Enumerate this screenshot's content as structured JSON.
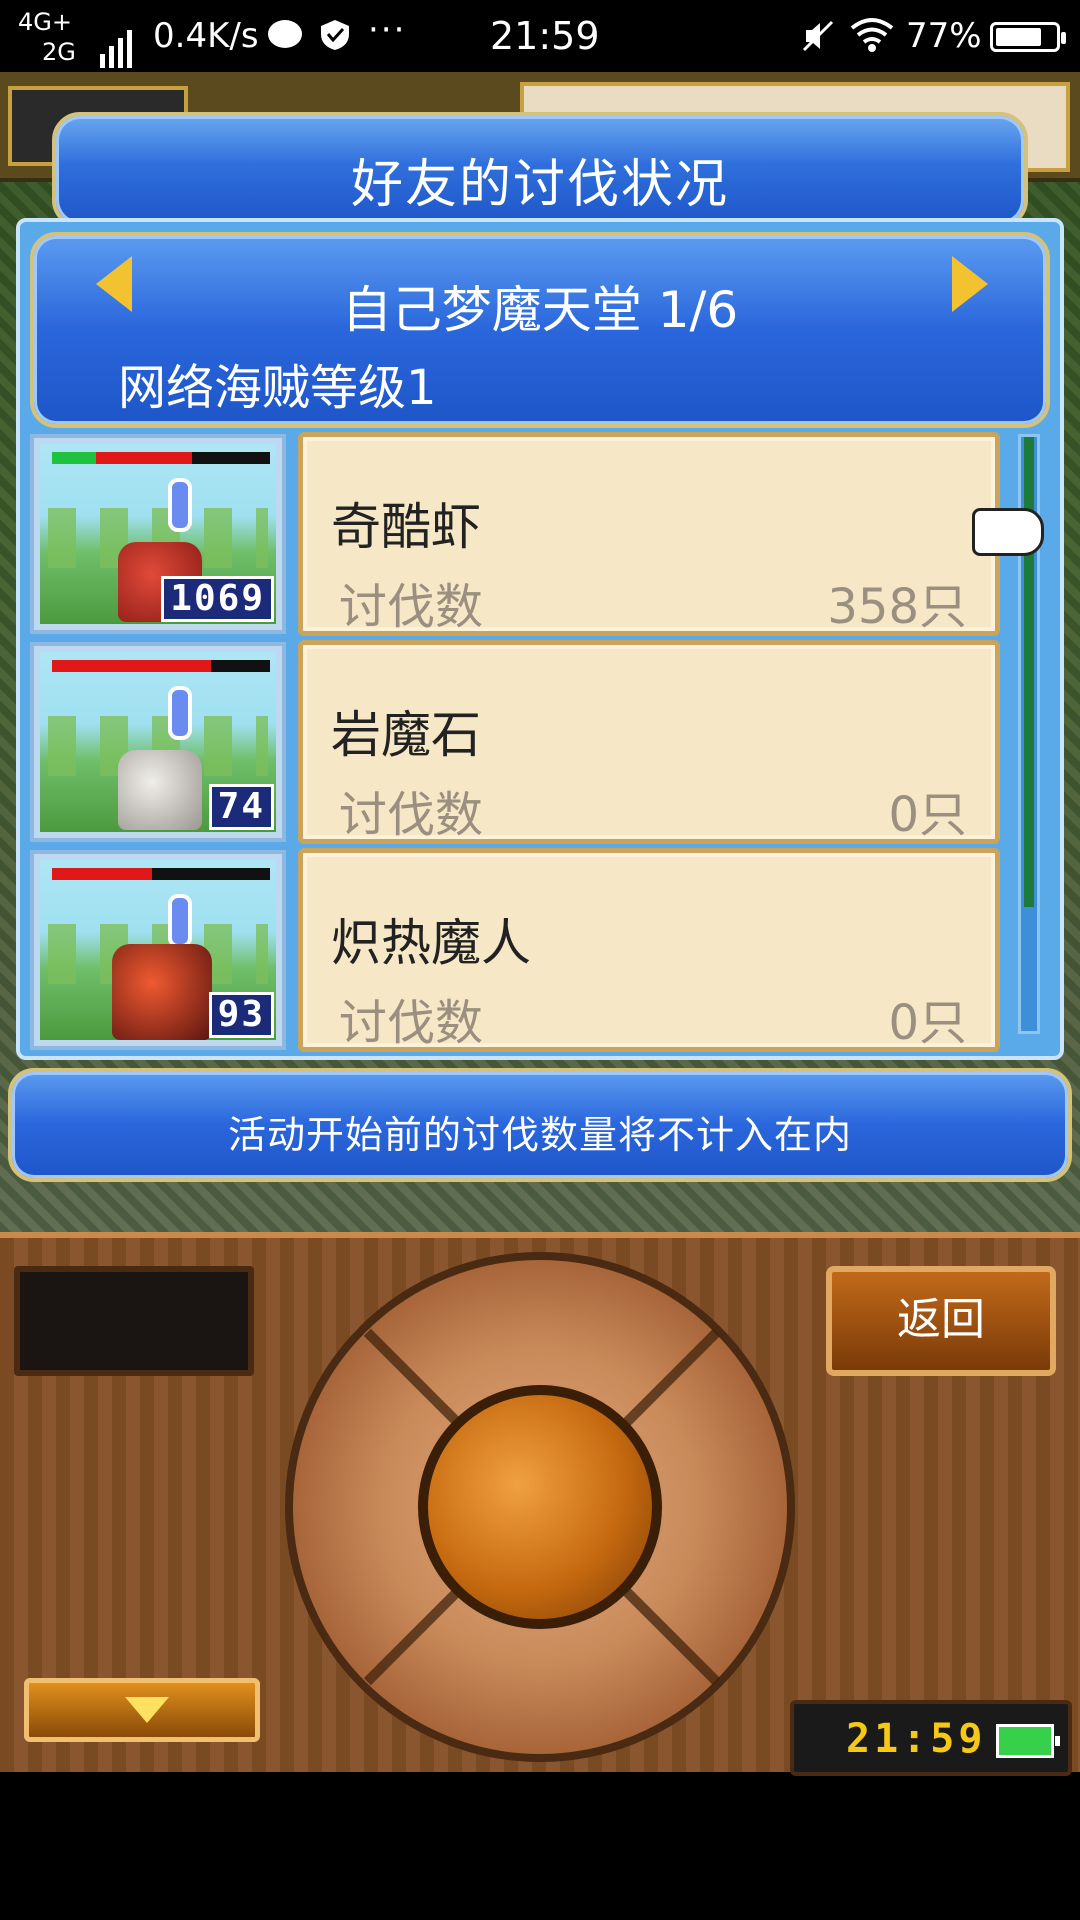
{
  "status_bar": {
    "network_1": "4G+",
    "network_2": "2G",
    "speed": "0.4K/s",
    "more": "···",
    "time": "21:59",
    "battery_pct": "77%",
    "battery_level": 0.77,
    "icons": [
      "message-icon",
      "shield-icon",
      "mute-icon",
      "wifi-icon",
      "battery-icon"
    ]
  },
  "title_panel": {
    "title": "好友的讨伐状况"
  },
  "header": {
    "dungeon": "自己梦魔天堂 1/6",
    "pirate_level": "网络海贼等级1"
  },
  "monsters": [
    {
      "name": "奇酷虾",
      "kill_label": "讨伐数",
      "kill_count": "358只",
      "level": "1069",
      "hp_green": 0.2,
      "hp_red": 0.44
    },
    {
      "name": "岩魔石",
      "kill_label": "讨伐数",
      "kill_count": "0只",
      "level": "74",
      "hp_green": 0,
      "hp_red": 0.73
    },
    {
      "name": "炽热魔人",
      "kill_label": "讨伐数",
      "kill_count": "0只",
      "level": "93",
      "hp_green": 0,
      "hp_red": 0.46
    }
  ],
  "notice": "活动开始前的讨伐数量将不计入在内",
  "controller": {
    "back_label": "返回",
    "clock": "21:59"
  },
  "colors": {
    "panel_blue": "#2f6fdc",
    "panel_border": "#d4c27a",
    "card_bg": "#f6e8c6",
    "accent_yellow": "#f2c230"
  }
}
